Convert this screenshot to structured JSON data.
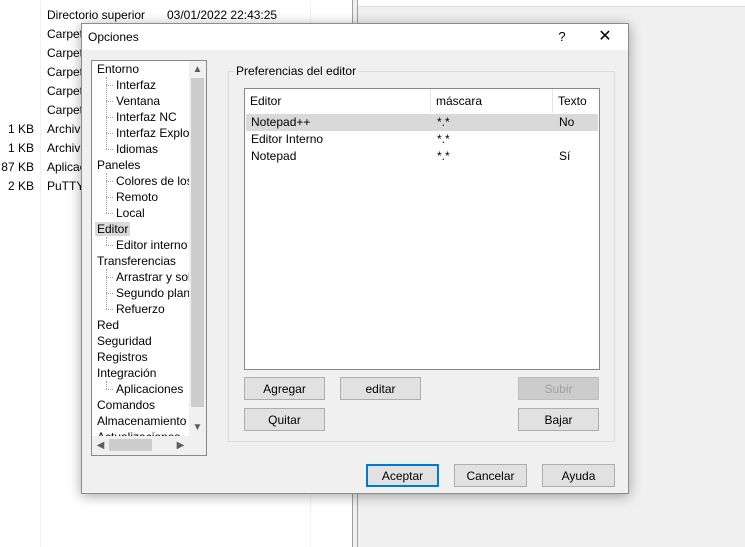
{
  "file_list": {
    "rows": [
      {
        "size": "",
        "name": "Directorio superior",
        "date": "03/01/2022  22:43:25"
      },
      {
        "size": "",
        "name": "Carpet",
        "date": ""
      },
      {
        "size": "",
        "name": "Carpet",
        "date": ""
      },
      {
        "size": "",
        "name": "Carpet",
        "date": ""
      },
      {
        "size": "",
        "name": "Carpet",
        "date": ""
      },
      {
        "size": "",
        "name": "Carpet",
        "date": ""
      },
      {
        "size": "1 KB",
        "name": "Archiv",
        "date": ""
      },
      {
        "size": "1 KB",
        "name": "Archiv",
        "date": ""
      },
      {
        "size": "87 KB",
        "name": "Aplicac",
        "date": ""
      },
      {
        "size": "2 KB",
        "name": "PuTTY",
        "date": ""
      }
    ]
  },
  "dialog": {
    "title": "Opciones",
    "help_glyph": "?",
    "close_glyph": "✕",
    "tree": {
      "items": [
        {
          "label": "Entorno",
          "level": 0
        },
        {
          "label": "Interfaz",
          "level": 1
        },
        {
          "label": "Ventana",
          "level": 1
        },
        {
          "label": "Interfaz NC",
          "level": 1
        },
        {
          "label": "Interfaz Explorer",
          "level": 1
        },
        {
          "label": "Idiomas",
          "level": 1
        },
        {
          "label": "Paneles",
          "level": 0
        },
        {
          "label": "Colores de los archivos",
          "level": 1
        },
        {
          "label": "Remoto",
          "level": 1
        },
        {
          "label": "Local",
          "level": 1
        },
        {
          "label": "Editor",
          "level": 0,
          "selected": true
        },
        {
          "label": "Editor interno",
          "level": 1
        },
        {
          "label": "Transferencias",
          "level": 0
        },
        {
          "label": "Arrastrar y soltar",
          "level": 1
        },
        {
          "label": "Segundo plano",
          "level": 1
        },
        {
          "label": "Refuerzo",
          "level": 1
        },
        {
          "label": "Red",
          "level": 0
        },
        {
          "label": "Seguridad",
          "level": 0
        },
        {
          "label": "Registros",
          "level": 0
        },
        {
          "label": "Integración",
          "level": 0
        },
        {
          "label": "Aplicaciones",
          "level": 1
        },
        {
          "label": "Comandos",
          "level": 0
        },
        {
          "label": "Almacenamiento",
          "level": 0
        },
        {
          "label": "Actualizaciones",
          "level": 0
        }
      ]
    },
    "group_title": "Preferencias del editor",
    "editor_list": {
      "columns": [
        "Editor",
        "máscara",
        "Texto"
      ],
      "rows": [
        {
          "editor": "Notepad++",
          "mask": "*.*",
          "text": "No",
          "selected": true
        },
        {
          "editor": "Editor Interno",
          "mask": "*.*",
          "text": ""
        },
        {
          "editor": "Notepad",
          "mask": "*.*",
          "text": "Sí"
        }
      ]
    },
    "buttons": {
      "add": "Agregar",
      "edit": "editar",
      "up": "Subir",
      "remove": "Quitar",
      "down": "Bajar",
      "ok": "Aceptar",
      "cancel": "Cancelar",
      "help": "Ayuda"
    }
  }
}
